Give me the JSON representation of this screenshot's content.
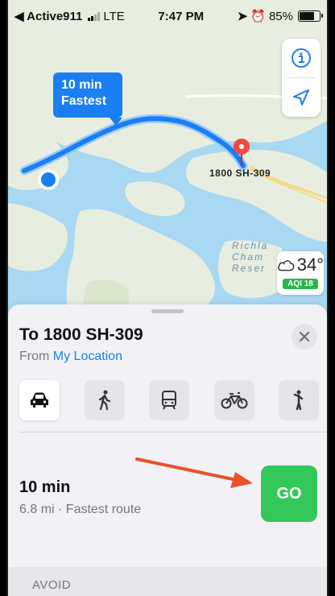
{
  "status_bar": {
    "carrier": "◀ Active911",
    "network": "LTE",
    "time": "7:47 PM",
    "battery": "85%"
  },
  "map": {
    "route_callout_time": "10 min",
    "route_callout_label": "Fastest",
    "destination_label": "1800 SH-309",
    "water_label_1": "Richla",
    "water_label_2": "Cham",
    "water_label_3": "Reser",
    "weather_temp": "34°",
    "aqi": "AQI 18",
    "colors": {
      "route": "#1a7ff2",
      "pin": "#f04a3c",
      "water": "#a9d8f2",
      "land": "#e8eedf"
    }
  },
  "sheet": {
    "title": "To 1800 SH-309",
    "from_prefix": "From",
    "from_link": "My Location",
    "modes": [
      "car-icon",
      "walk-icon",
      "transit-icon",
      "bike-icon",
      "rideshare-icon"
    ],
    "route_time": "10 min",
    "route_info": "6.8 mi · Fastest route",
    "go_label": "GO",
    "avoid_label": "AVOID"
  }
}
